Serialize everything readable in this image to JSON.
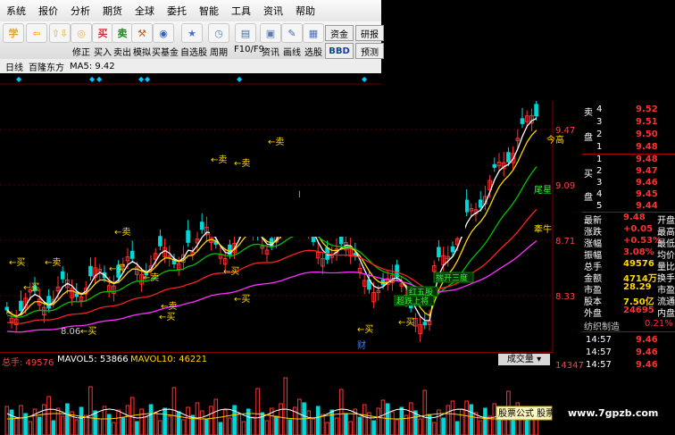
{
  "menu": [
    "系统",
    "报价",
    "分析",
    "期货",
    "全球",
    "委托",
    "智能",
    "工具",
    "资讯",
    "帮助"
  ],
  "toolbar": [
    {
      "label": "",
      "icon": "学",
      "color": "#e8a02a"
    },
    {
      "label": "",
      "icon": "⇦",
      "color": "#f2b33a"
    },
    {
      "label": "",
      "icon": "⇧⇩",
      "color": "#e6c35c"
    },
    {
      "label": "修正",
      "icon": "◎",
      "color": "#f0b050"
    },
    {
      "label": "买入",
      "icon": "买",
      "color": "#d03030"
    },
    {
      "label": "卖出",
      "icon": "卖",
      "color": "#208a20"
    },
    {
      "label": "模拟",
      "icon": "⚒",
      "color": "#c06020"
    },
    {
      "label": "买基金",
      "icon": "◉",
      "color": "#3060c0"
    },
    {
      "label": "自选股",
      "icon": "★",
      "color": "#4070d0"
    },
    {
      "label": "周期",
      "icon": "◷",
      "color": "#5080c0"
    },
    {
      "label": "F10/F9",
      "icon": "▤",
      "color": "#4070a0"
    },
    {
      "label": "资讯",
      "icon": "▣",
      "color": "#5a7ab0"
    },
    {
      "label": "画线",
      "icon": "✎",
      "color": "#3a6ab0"
    },
    {
      "label": "选股",
      "icon": "▦",
      "color": "#4a70c0"
    }
  ],
  "toolbar_extra": [
    "资金",
    "研报",
    "BBD",
    "预测"
  ],
  "infobar": {
    "period": "日线",
    "stock": "百隆东方",
    "ma": "MA5: 9.42"
  },
  "price_ticks": [
    "9.47",
    "9.09",
    "8.71",
    "8.33"
  ],
  "right_labels": [
    "今高",
    "尾星",
    "牽牛"
  ],
  "chart_annotations": {
    "sell": "←卖",
    "buy": "←买",
    "low": "8.06",
    "cai": "财",
    "green_tags": [
      "揣开三度",
      "红五股",
      "超跌上将"
    ]
  },
  "volume_header": {
    "total": "总手: 49576",
    "mavol5": "MAVOL5: 53866",
    "mavol10": "MAVOL10: 46221",
    "selector": "成交量",
    "right_value": "14347"
  },
  "volume_tag": "股票公式 股票软",
  "quote_sell": [
    {
      "lbl": "卖",
      "n": "4",
      "p": "9.52"
    },
    {
      "lbl": "",
      "n": "3",
      "p": "9.51"
    },
    {
      "lbl": "盘",
      "n": "2",
      "p": "9.50"
    },
    {
      "lbl": "",
      "n": "1",
      "p": "9.48"
    }
  ],
  "quote_buy": [
    {
      "lbl": "",
      "n": "1",
      "p": "9.48"
    },
    {
      "lbl": "买",
      "n": "2",
      "p": "9.47"
    },
    {
      "lbl": "",
      "n": "3",
      "p": "9.46"
    },
    {
      "lbl": "盘",
      "n": "4",
      "p": "9.45"
    },
    {
      "lbl": "",
      "n": "5",
      "p": "9.44"
    }
  ],
  "stats": [
    {
      "k": "最新",
      "v": "9.48",
      "k2": "开盘"
    },
    {
      "k": "涨跌",
      "v": "+0.05",
      "k2": "最高"
    },
    {
      "k": "涨幅",
      "v": "+0.53%",
      "k2": "最低"
    },
    {
      "k": "振幅",
      "v": "3.08%",
      "k2": "均价"
    },
    {
      "k": "总手",
      "v": "49576",
      "k2": "量比"
    },
    {
      "k": "金额",
      "v": "4714万",
      "k2": "换手"
    },
    {
      "k": "市盈",
      "v": "28.29",
      "k2": "市盈"
    },
    {
      "k": "股本",
      "v": "7.50亿",
      "k2": "流通"
    },
    {
      "k": "外盘",
      "v": "24695",
      "k2": "内盘"
    }
  ],
  "industry": {
    "name": "纺织制造",
    "pct": "0.21%"
  },
  "ticks": [
    {
      "t": "14:57",
      "p": "9.46"
    },
    {
      "t": "14:57",
      "p": "9.46"
    },
    {
      "t": "14:57",
      "p": "9.46"
    }
  ],
  "watermark": "www.7gpzb.com",
  "colors": {
    "up": "#ff3232",
    "down": "#00d8d8",
    "ma5": "#ffffff",
    "ma10": "#ffd700",
    "ma20": "#00c000",
    "ma60": "#ff30ff",
    "ma30": "#ff2020"
  }
}
